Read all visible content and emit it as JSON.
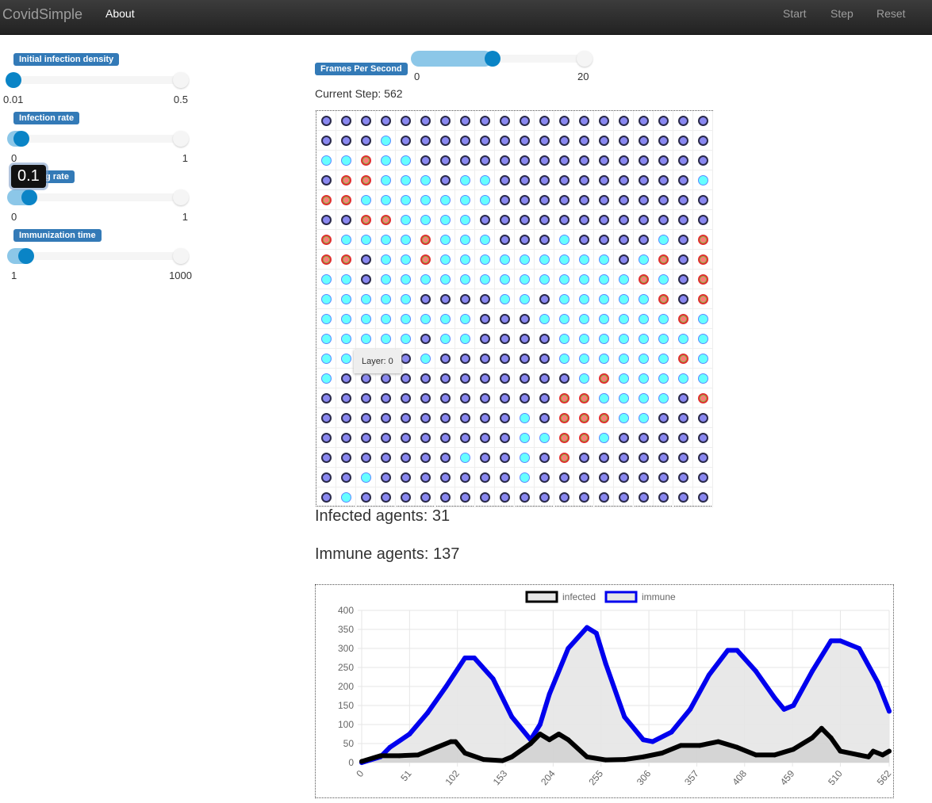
{
  "navbar": {
    "brand": "CovidSimple",
    "about": "About",
    "start": "Start",
    "step": "Step",
    "reset": "Reset"
  },
  "sliders": [
    {
      "label": "Initial infection density",
      "min": "0.01",
      "max": "0.5",
      "value": 0.01
    },
    {
      "label": "Infection rate",
      "min": "0",
      "max": "1",
      "value": 0.05
    },
    {
      "label": "Healing rate",
      "min": "0",
      "max": "1",
      "value": 0.1,
      "tooltip": "0.1"
    },
    {
      "label": "Immunization time",
      "min": "1",
      "max": "1000",
      "value": 80
    }
  ],
  "fps": {
    "label": "Frames Per Second",
    "min": "0",
    "max": "20",
    "value": 10
  },
  "current_step": "Current Step: 562",
  "grid": {
    "rows": [
      "SSSSSSSSSSSSSSSSSSSS",
      "SSSMSSSSSSSSSSSSSSSS",
      "MMIMMSSSSSSSSSSSSSSS",
      "SIIMMMSMMSSSSSSSSSSM",
      "IIMMMMMMMSSSSSSSSSSS",
      "SSIIMMMMSSSSSSSSSSSS",
      "IMMMMIMMMSSSMSSSSMSI",
      "IISMMIMMMMMMMMMSMISI",
      "MMSMMMMMMMMMMMMMIMSI",
      "MMMMMSSSSMMSMMMMMISI",
      "MMMMMMMMSSSMMMMMMMIM",
      "MMMMMSMMSSSSMMMMMMMM",
      "MMSSSMSSSSSSMMMMMMIM",
      "MSSSSSSSSSSSSMIMMMMM",
      "SSSSSSSSSSSSIIMMMMSI",
      "SSSSSSSSSSMSIIIMMSSS",
      "SSSSSSSSSSMMIIMSSSSS",
      "SSSSSSSMSSMSISSSSSSS",
      "SSMSSSSSSSMSSSSSSSSS",
      "SMSSSSSSSSSSSSSSSSSS"
    ],
    "colors": {
      "S": "#8a88f0",
      "M": "#66ffff",
      "I": "#ff7a7a"
    },
    "tooltip": "Layer: 0"
  },
  "infected_text": "Infected agents: 31",
  "immune_text": "Immune agents: 137",
  "chart_data": {
    "type": "line",
    "xlim": [
      0,
      562
    ],
    "ylim": [
      0,
      400
    ],
    "xticks": [
      "0",
      "51",
      "102",
      "153",
      "204",
      "255",
      "306",
      "357",
      "408",
      "459",
      "510",
      "562"
    ],
    "yticks": [
      "0",
      "50",
      "100",
      "150",
      "200",
      "250",
      "300",
      "350",
      "400"
    ],
    "grid": true,
    "legend": "top",
    "series": [
      {
        "name": "infected",
        "color": "#000000",
        "fill": "#d0d0d0",
        "points": [
          [
            0,
            3
          ],
          [
            20,
            18
          ],
          [
            40,
            18
          ],
          [
            60,
            20
          ],
          [
            80,
            40
          ],
          [
            95,
            55
          ],
          [
            100,
            55
          ],
          [
            110,
            25
          ],
          [
            130,
            8
          ],
          [
            150,
            5
          ],
          [
            160,
            15
          ],
          [
            180,
            50
          ],
          [
            190,
            75
          ],
          [
            200,
            60
          ],
          [
            210,
            75
          ],
          [
            220,
            60
          ],
          [
            240,
            15
          ],
          [
            260,
            7
          ],
          [
            280,
            8
          ],
          [
            300,
            15
          ],
          [
            320,
            25
          ],
          [
            340,
            45
          ],
          [
            360,
            45
          ],
          [
            380,
            55
          ],
          [
            400,
            40
          ],
          [
            420,
            20
          ],
          [
            440,
            20
          ],
          [
            460,
            35
          ],
          [
            480,
            65
          ],
          [
            490,
            90
          ],
          [
            500,
            65
          ],
          [
            510,
            30
          ],
          [
            530,
            20
          ],
          [
            540,
            15
          ],
          [
            545,
            30
          ],
          [
            555,
            20
          ],
          [
            562,
            30
          ]
        ]
      },
      {
        "name": "immune",
        "color": "#0000ee",
        "fill": "#e6e6e6",
        "points": [
          [
            0,
            0
          ],
          [
            20,
            15
          ],
          [
            30,
            40
          ],
          [
            51,
            75
          ],
          [
            70,
            130
          ],
          [
            90,
            200
          ],
          [
            110,
            275
          ],
          [
            120,
            275
          ],
          [
            140,
            220
          ],
          [
            160,
            120
          ],
          [
            180,
            60
          ],
          [
            190,
            100
          ],
          [
            200,
            180
          ],
          [
            220,
            300
          ],
          [
            240,
            355
          ],
          [
            250,
            340
          ],
          [
            260,
            260
          ],
          [
            280,
            120
          ],
          [
            300,
            60
          ],
          [
            310,
            55
          ],
          [
            330,
            80
          ],
          [
            350,
            140
          ],
          [
            370,
            230
          ],
          [
            390,
            295
          ],
          [
            400,
            295
          ],
          [
            420,
            240
          ],
          [
            440,
            170
          ],
          [
            450,
            140
          ],
          [
            460,
            150
          ],
          [
            480,
            240
          ],
          [
            500,
            320
          ],
          [
            510,
            320
          ],
          [
            530,
            300
          ],
          [
            550,
            210
          ],
          [
            562,
            135
          ]
        ]
      }
    ]
  }
}
